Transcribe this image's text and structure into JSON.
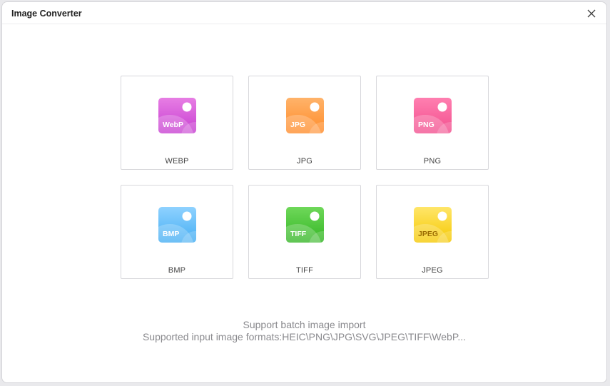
{
  "window": {
    "title": "Image Converter"
  },
  "formats": [
    {
      "label": "WEBP",
      "badge": "WebP",
      "color_top": "#e77ee4",
      "color_bottom": "#c73fd1",
      "icon": "webp-file-icon"
    },
    {
      "label": "JPG",
      "badge": "JPG",
      "color_top": "#ffb36a",
      "color_bottom": "#ff8c2a",
      "icon": "jpg-file-icon"
    },
    {
      "label": "PNG",
      "badge": "PNG",
      "color_top": "#ff7fb0",
      "color_bottom": "#f24f8e",
      "icon": "png-file-icon"
    },
    {
      "label": "BMP",
      "badge": "BMP",
      "color_top": "#8fd2ff",
      "color_bottom": "#45aef3",
      "icon": "bmp-file-icon"
    },
    {
      "label": "TIFF",
      "badge": "TIFF",
      "color_top": "#6fd85a",
      "color_bottom": "#33b524",
      "icon": "tiff-file-icon"
    },
    {
      "label": "JPEG",
      "badge": "JPEG",
      "color_top": "#ffe66a",
      "color_bottom": "#f5c800",
      "icon": "jpeg-file-icon"
    }
  ],
  "info": {
    "line1": "Support batch image import",
    "line2": "Supported input image formats:HEIC\\PNG\\JPG\\SVG\\JPEG\\TIFF\\WebP..."
  }
}
